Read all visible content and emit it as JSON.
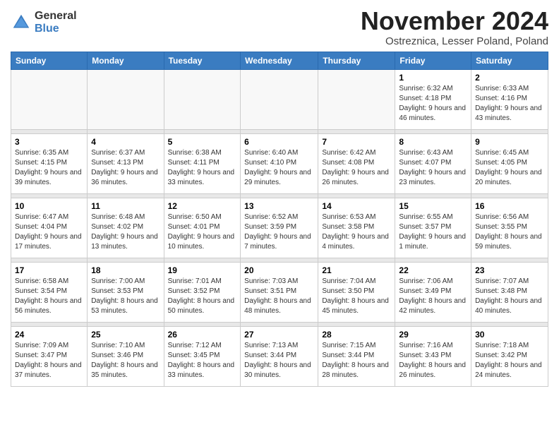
{
  "logo": {
    "general": "General",
    "blue": "Blue"
  },
  "title": {
    "month": "November 2024",
    "location": "Ostreznica, Lesser Poland, Poland"
  },
  "days_of_week": [
    "Sunday",
    "Monday",
    "Tuesday",
    "Wednesday",
    "Thursday",
    "Friday",
    "Saturday"
  ],
  "weeks": [
    {
      "days": [
        {
          "num": "",
          "detail": ""
        },
        {
          "num": "",
          "detail": ""
        },
        {
          "num": "",
          "detail": ""
        },
        {
          "num": "",
          "detail": ""
        },
        {
          "num": "",
          "detail": ""
        },
        {
          "num": "1",
          "detail": "Sunrise: 6:32 AM\nSunset: 4:18 PM\nDaylight: 9 hours\nand 46 minutes."
        },
        {
          "num": "2",
          "detail": "Sunrise: 6:33 AM\nSunset: 4:16 PM\nDaylight: 9 hours\nand 43 minutes."
        }
      ]
    },
    {
      "days": [
        {
          "num": "3",
          "detail": "Sunrise: 6:35 AM\nSunset: 4:15 PM\nDaylight: 9 hours\nand 39 minutes."
        },
        {
          "num": "4",
          "detail": "Sunrise: 6:37 AM\nSunset: 4:13 PM\nDaylight: 9 hours\nand 36 minutes."
        },
        {
          "num": "5",
          "detail": "Sunrise: 6:38 AM\nSunset: 4:11 PM\nDaylight: 9 hours\nand 33 minutes."
        },
        {
          "num": "6",
          "detail": "Sunrise: 6:40 AM\nSunset: 4:10 PM\nDaylight: 9 hours\nand 29 minutes."
        },
        {
          "num": "7",
          "detail": "Sunrise: 6:42 AM\nSunset: 4:08 PM\nDaylight: 9 hours\nand 26 minutes."
        },
        {
          "num": "8",
          "detail": "Sunrise: 6:43 AM\nSunset: 4:07 PM\nDaylight: 9 hours\nand 23 minutes."
        },
        {
          "num": "9",
          "detail": "Sunrise: 6:45 AM\nSunset: 4:05 PM\nDaylight: 9 hours\nand 20 minutes."
        }
      ]
    },
    {
      "days": [
        {
          "num": "10",
          "detail": "Sunrise: 6:47 AM\nSunset: 4:04 PM\nDaylight: 9 hours\nand 17 minutes."
        },
        {
          "num": "11",
          "detail": "Sunrise: 6:48 AM\nSunset: 4:02 PM\nDaylight: 9 hours\nand 13 minutes."
        },
        {
          "num": "12",
          "detail": "Sunrise: 6:50 AM\nSunset: 4:01 PM\nDaylight: 9 hours\nand 10 minutes."
        },
        {
          "num": "13",
          "detail": "Sunrise: 6:52 AM\nSunset: 3:59 PM\nDaylight: 9 hours\nand 7 minutes."
        },
        {
          "num": "14",
          "detail": "Sunrise: 6:53 AM\nSunset: 3:58 PM\nDaylight: 9 hours\nand 4 minutes."
        },
        {
          "num": "15",
          "detail": "Sunrise: 6:55 AM\nSunset: 3:57 PM\nDaylight: 9 hours\nand 1 minute."
        },
        {
          "num": "16",
          "detail": "Sunrise: 6:56 AM\nSunset: 3:55 PM\nDaylight: 8 hours\nand 59 minutes."
        }
      ]
    },
    {
      "days": [
        {
          "num": "17",
          "detail": "Sunrise: 6:58 AM\nSunset: 3:54 PM\nDaylight: 8 hours\nand 56 minutes."
        },
        {
          "num": "18",
          "detail": "Sunrise: 7:00 AM\nSunset: 3:53 PM\nDaylight: 8 hours\nand 53 minutes."
        },
        {
          "num": "19",
          "detail": "Sunrise: 7:01 AM\nSunset: 3:52 PM\nDaylight: 8 hours\nand 50 minutes."
        },
        {
          "num": "20",
          "detail": "Sunrise: 7:03 AM\nSunset: 3:51 PM\nDaylight: 8 hours\nand 48 minutes."
        },
        {
          "num": "21",
          "detail": "Sunrise: 7:04 AM\nSunset: 3:50 PM\nDaylight: 8 hours\nand 45 minutes."
        },
        {
          "num": "22",
          "detail": "Sunrise: 7:06 AM\nSunset: 3:49 PM\nDaylight: 8 hours\nand 42 minutes."
        },
        {
          "num": "23",
          "detail": "Sunrise: 7:07 AM\nSunset: 3:48 PM\nDaylight: 8 hours\nand 40 minutes."
        }
      ]
    },
    {
      "days": [
        {
          "num": "24",
          "detail": "Sunrise: 7:09 AM\nSunset: 3:47 PM\nDaylight: 8 hours\nand 37 minutes."
        },
        {
          "num": "25",
          "detail": "Sunrise: 7:10 AM\nSunset: 3:46 PM\nDaylight: 8 hours\nand 35 minutes."
        },
        {
          "num": "26",
          "detail": "Sunrise: 7:12 AM\nSunset: 3:45 PM\nDaylight: 8 hours\nand 33 minutes."
        },
        {
          "num": "27",
          "detail": "Sunrise: 7:13 AM\nSunset: 3:44 PM\nDaylight: 8 hours\nand 30 minutes."
        },
        {
          "num": "28",
          "detail": "Sunrise: 7:15 AM\nSunset: 3:44 PM\nDaylight: 8 hours\nand 28 minutes."
        },
        {
          "num": "29",
          "detail": "Sunrise: 7:16 AM\nSunset: 3:43 PM\nDaylight: 8 hours\nand 26 minutes."
        },
        {
          "num": "30",
          "detail": "Sunrise: 7:18 AM\nSunset: 3:42 PM\nDaylight: 8 hours\nand 24 minutes."
        }
      ]
    }
  ]
}
